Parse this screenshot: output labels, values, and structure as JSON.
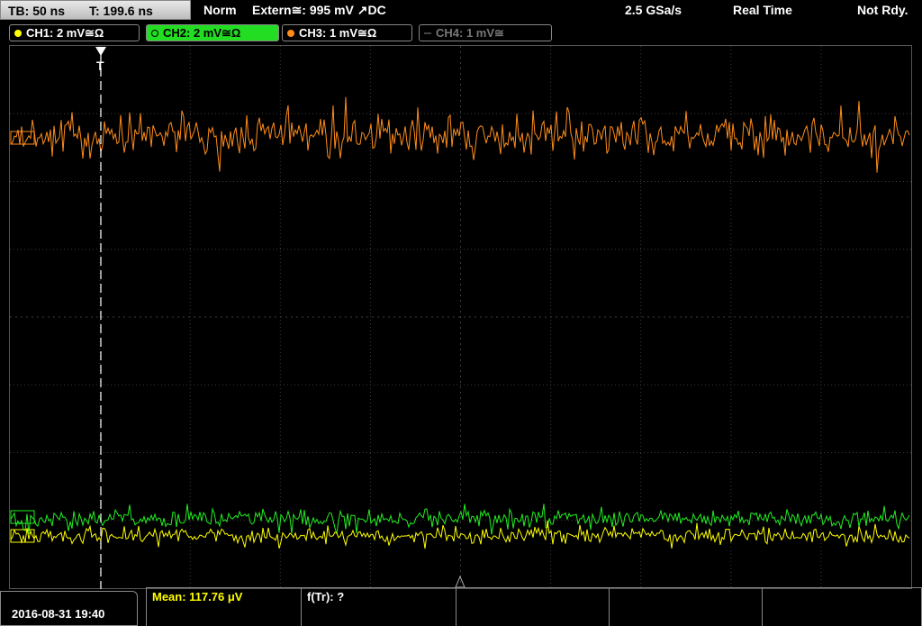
{
  "topbar": {
    "tb": "TB: 50 ns",
    "t": "T: 199.6 ns",
    "mode": "Norm",
    "trigger": "Extern≅: 995 mV ↗DC",
    "rate": "2.5 GSa/s",
    "acq": "Real Time",
    "status": "Not Rdy."
  },
  "channels": [
    {
      "label": "CH1: 2 mV≅Ω",
      "color": "#ffff00"
    },
    {
      "label": "CH2: 2 mV≅Ω",
      "color": "#00ff00"
    },
    {
      "label": "CH3: 1 mV≅Ω",
      "color": "#ff8c1a"
    },
    {
      "label": "CH4: 1 mV≅",
      "color": "#777777"
    }
  ],
  "trigger_marker": "T",
  "footer": {
    "datetime": "2016-08-31 19:40",
    "mean": "Mean: 117.76 μV",
    "freq": "f(Tr): ?"
  },
  "traces": {
    "ch3_color": "#ff8c1a",
    "ch2_color": "#22ee22",
    "ch1_color": "#ffff00"
  }
}
